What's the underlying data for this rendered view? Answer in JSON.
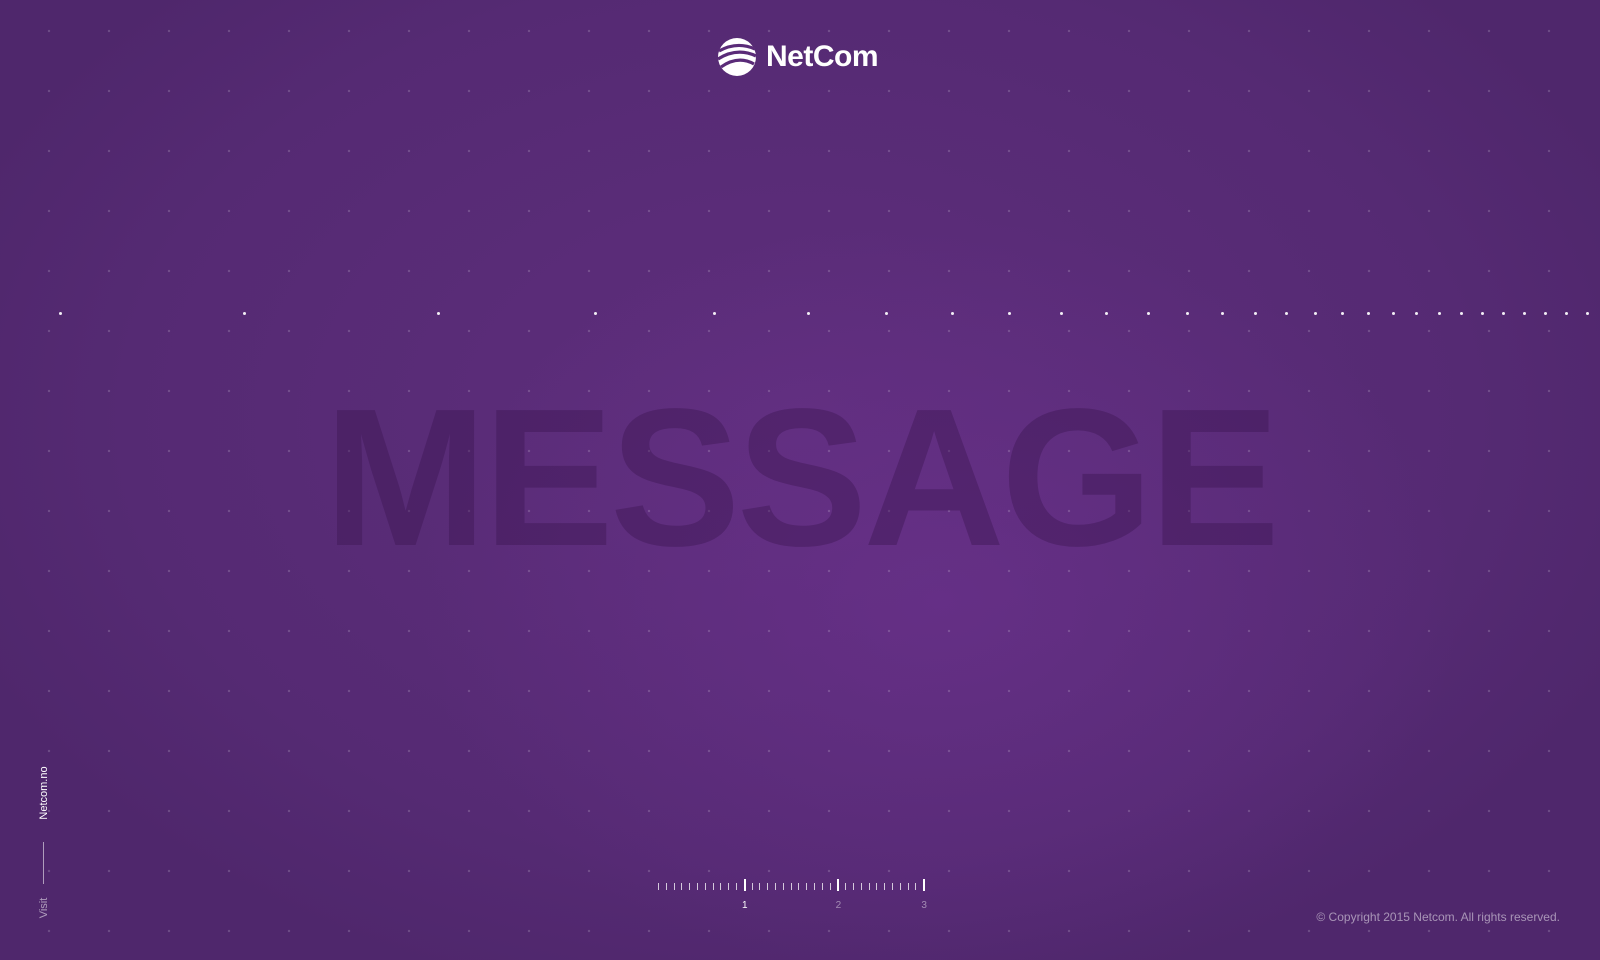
{
  "brand": {
    "name": "NetCom",
    "logo_icon": "netcom-globe-icon",
    "text_color": "#ffffff"
  },
  "background": {
    "base_color": "#572a75",
    "glow_color": "#6e3291"
  },
  "hero": {
    "word": "MESSAGE",
    "word_color": "#3c1652"
  },
  "sidebar": {
    "link_label": "Netcom.no",
    "visit_label": "Visit"
  },
  "pager": {
    "labels": [
      "1",
      "2",
      "3"
    ],
    "current": "1"
  },
  "footer": {
    "copyright": "© Copyright 2015 Netcom. All rights reserved."
  }
}
